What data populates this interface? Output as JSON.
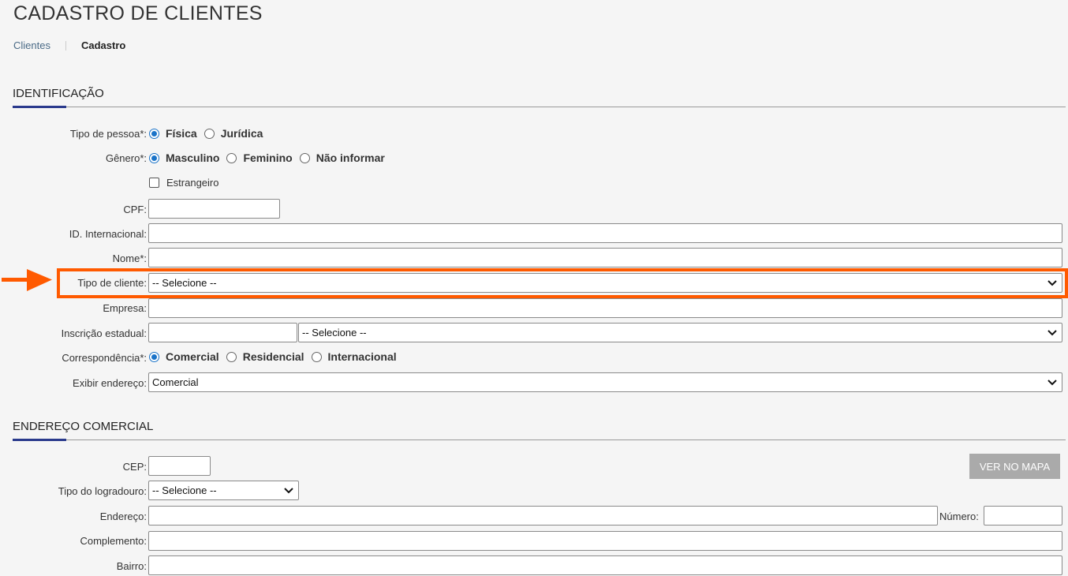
{
  "page": {
    "title": "CADASTRO DE CLIENTES",
    "breadcrumb": {
      "parent": "Clientes",
      "current": "Cadastro"
    }
  },
  "identificacao": {
    "section_title": "IDENTIFICAÇÃO",
    "tipo_pessoa": {
      "label": "Tipo de pessoa*:",
      "options": [
        "Física",
        "Jurídica"
      ],
      "selected": "Física"
    },
    "genero": {
      "label": "Gênero*:",
      "options": [
        "Masculino",
        "Feminino",
        "Não informar"
      ],
      "selected": "Masculino"
    },
    "estrangeiro": {
      "label": "Estrangeiro",
      "checked": false
    },
    "cpf": {
      "label": "CPF:",
      "value": ""
    },
    "id_internacional": {
      "label": "ID. Internacional:",
      "value": ""
    },
    "nome": {
      "label": "Nome*:",
      "value": ""
    },
    "tipo_cliente": {
      "label": "Tipo de cliente:",
      "value": "-- Selecione --"
    },
    "empresa": {
      "label": "Empresa:",
      "value": ""
    },
    "inscricao_estadual": {
      "label": "Inscrição estadual:",
      "value": "",
      "select_value": "-- Selecione --"
    },
    "correspondencia": {
      "label": "Correspondência*:",
      "options": [
        "Comercial",
        "Residencial",
        "Internacional"
      ],
      "selected": "Comercial"
    },
    "exibir_endereco": {
      "label": "Exibir endereço:",
      "value": "Comercial"
    }
  },
  "endereco_comercial": {
    "section_title": "ENDEREÇO COMERCIAL",
    "cep": {
      "label": "CEP:",
      "value": ""
    },
    "ver_no_mapa": "VER NO MAPA",
    "tipo_logradouro": {
      "label": "Tipo do logradouro:",
      "value": "-- Selecione --"
    },
    "endereco": {
      "label": "Endereço:",
      "value": ""
    },
    "numero": {
      "label": "Número:",
      "value": ""
    },
    "complemento": {
      "label": "Complemento:",
      "value": ""
    },
    "bairro": {
      "label": "Bairro:",
      "value": ""
    }
  },
  "colors": {
    "accent": "#1a73c8",
    "highlight": "#ff5a00",
    "section_bar": "#2a3a8c"
  }
}
